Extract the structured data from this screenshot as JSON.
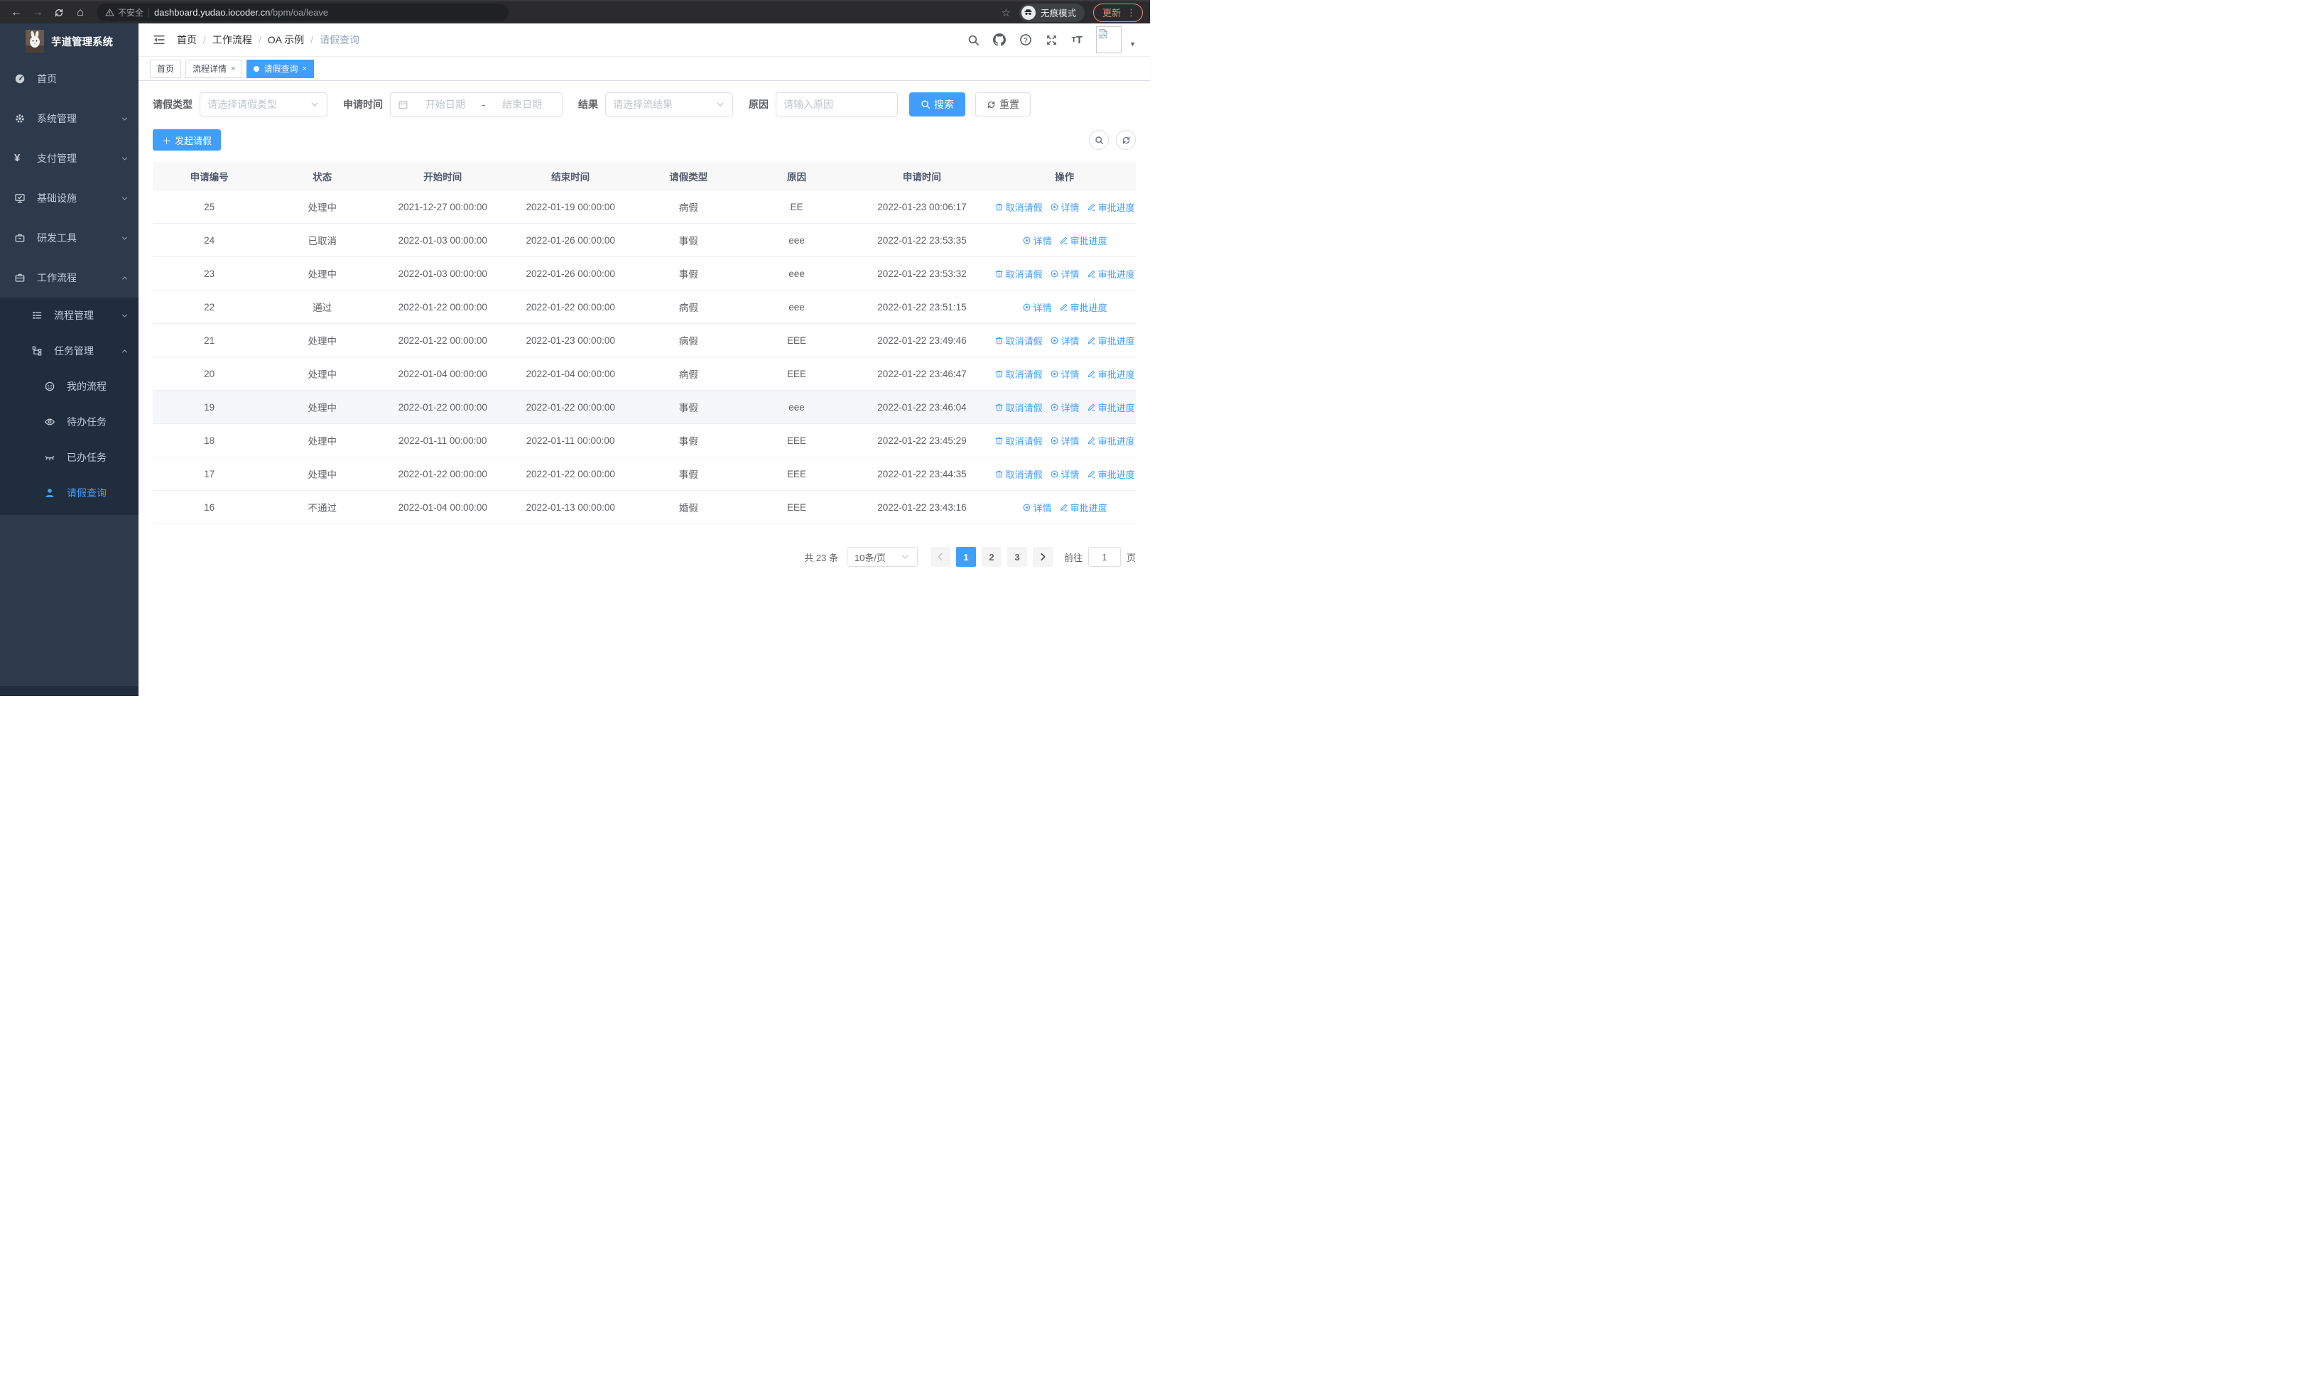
{
  "browser": {
    "security_label": "不安全",
    "url_host": "dashboard.yudao.iocoder.cn",
    "url_path": "/bpm/oa/leave",
    "incognito_label": "无痕模式",
    "update_label": "更新"
  },
  "sidebar": {
    "title": "芋道管理系统",
    "items": [
      {
        "icon": "dashboard-icon",
        "label": "首页"
      },
      {
        "icon": "gear-icon",
        "label": "系统管理",
        "chevron": "down"
      },
      {
        "icon": "yen-icon",
        "label": "支付管理",
        "chevron": "down"
      },
      {
        "icon": "monitor-icon",
        "label": "基础设施",
        "chevron": "down"
      },
      {
        "icon": "toolbox-icon",
        "label": "研发工具",
        "chevron": "down"
      },
      {
        "icon": "briefcase-icon",
        "label": "工作流程",
        "chevron": "up",
        "expanded": true,
        "children": [
          {
            "icon": "list-icon",
            "label": "流程管理",
            "chevron": "down"
          },
          {
            "icon": "tree-icon",
            "label": "任务管理",
            "chevron": "up",
            "expanded": true,
            "children": [
              {
                "icon": "face-icon",
                "label": "我的流程"
              },
              {
                "icon": "eye-icon",
                "label": "待办任务"
              },
              {
                "icon": "eye-closed-icon",
                "label": "已办任务"
              },
              {
                "icon": "user-icon",
                "label": "请假查询",
                "active": true
              }
            ]
          }
        ]
      }
    ]
  },
  "navbar": {
    "breadcrumb": [
      "首页",
      "工作流程",
      "OA 示例",
      "请假查询"
    ]
  },
  "tags": [
    {
      "label": "首页",
      "active": false,
      "closable": false
    },
    {
      "label": "流程详情",
      "active": false,
      "closable": true
    },
    {
      "label": "请假查询",
      "active": true,
      "closable": true
    }
  ],
  "filters": {
    "type_label": "请假类型",
    "type_placeholder": "请选择请假类型",
    "time_label": "申请时间",
    "start_placeholder": "开始日期",
    "range_separator": "-",
    "end_placeholder": "结束日期",
    "result_label": "结果",
    "result_placeholder": "请选择流结果",
    "reason_label": "原因",
    "reason_placeholder": "请输入原因",
    "search_label": "搜索",
    "reset_label": "重置"
  },
  "toolbar": {
    "create_label": "发起请假"
  },
  "table": {
    "columns": [
      "申请编号",
      "状态",
      "开始时间",
      "结束时间",
      "请假类型",
      "原因",
      "申请时间",
      "操作"
    ],
    "action_labels": {
      "cancel": "取消请假",
      "detail": "详情",
      "progress": "审批进度"
    },
    "rows": [
      {
        "id": "25",
        "status": "处理中",
        "start": "2021-12-27 00:00:00",
        "end": "2022-01-19 00:00:00",
        "type": "病假",
        "reason": "EE",
        "apply": "2022-01-23 00:06:17",
        "actions": [
          "cancel",
          "detail",
          "progress"
        ],
        "hover": false
      },
      {
        "id": "24",
        "status": "已取消",
        "start": "2022-01-03 00:00:00",
        "end": "2022-01-26 00:00:00",
        "type": "事假",
        "reason": "eee",
        "apply": "2022-01-22 23:53:35",
        "actions": [
          "detail",
          "progress"
        ],
        "hover": false
      },
      {
        "id": "23",
        "status": "处理中",
        "start": "2022-01-03 00:00:00",
        "end": "2022-01-26 00:00:00",
        "type": "事假",
        "reason": "eee",
        "apply": "2022-01-22 23:53:32",
        "actions": [
          "cancel",
          "detail",
          "progress"
        ],
        "hover": false
      },
      {
        "id": "22",
        "status": "通过",
        "start": "2022-01-22 00:00:00",
        "end": "2022-01-22 00:00:00",
        "type": "病假",
        "reason": "eee",
        "apply": "2022-01-22 23:51:15",
        "actions": [
          "detail",
          "progress"
        ],
        "hover": false
      },
      {
        "id": "21",
        "status": "处理中",
        "start": "2022-01-22 00:00:00",
        "end": "2022-01-23 00:00:00",
        "type": "病假",
        "reason": "EEE",
        "apply": "2022-01-22 23:49:46",
        "actions": [
          "cancel",
          "detail",
          "progress"
        ],
        "hover": false
      },
      {
        "id": "20",
        "status": "处理中",
        "start": "2022-01-04 00:00:00",
        "end": "2022-01-04 00:00:00",
        "type": "病假",
        "reason": "EEE",
        "apply": "2022-01-22 23:46:47",
        "actions": [
          "cancel",
          "detail",
          "progress"
        ],
        "hover": false
      },
      {
        "id": "19",
        "status": "处理中",
        "start": "2022-01-22 00:00:00",
        "end": "2022-01-22 00:00:00",
        "type": "事假",
        "reason": "eee",
        "apply": "2022-01-22 23:46:04",
        "actions": [
          "cancel",
          "detail",
          "progress"
        ],
        "hover": true
      },
      {
        "id": "18",
        "status": "处理中",
        "start": "2022-01-11 00:00:00",
        "end": "2022-01-11 00:00:00",
        "type": "事假",
        "reason": "EEE",
        "apply": "2022-01-22 23:45:29",
        "actions": [
          "cancel",
          "detail",
          "progress"
        ],
        "hover": false
      },
      {
        "id": "17",
        "status": "处理中",
        "start": "2022-01-22 00:00:00",
        "end": "2022-01-22 00:00:00",
        "type": "事假",
        "reason": "EEE",
        "apply": "2022-01-22 23:44:35",
        "actions": [
          "cancel",
          "detail",
          "progress"
        ],
        "hover": false
      },
      {
        "id": "16",
        "status": "不通过",
        "start": "2022-01-04 00:00:00",
        "end": "2022-01-13 00:00:00",
        "type": "婚假",
        "reason": "EEE",
        "apply": "2022-01-22 23:43:16",
        "actions": [
          "detail",
          "progress"
        ],
        "hover": false
      }
    ]
  },
  "pagination": {
    "total_label": "共 23 条",
    "page_size_value": "10条/页",
    "pages": [
      "1",
      "2",
      "3"
    ],
    "active_page": "1",
    "goto_label": "前往",
    "goto_value": "1",
    "goto_suffix": "页"
  },
  "colors": {
    "accent_blue": "#409eff",
    "sidebar_bg": "#2d3a4b",
    "submenu_bg": "#1f2d3d",
    "sidebar_text": "#bfcbd9",
    "chrome_bg": "#2b2b2e",
    "urlbar_bg": "#202124",
    "update_pill": "#f28b82",
    "table_header_bg": "#f8f8f9",
    "table_border": "#ebeef5",
    "hover_row_bg": "#f5f7fa"
  }
}
